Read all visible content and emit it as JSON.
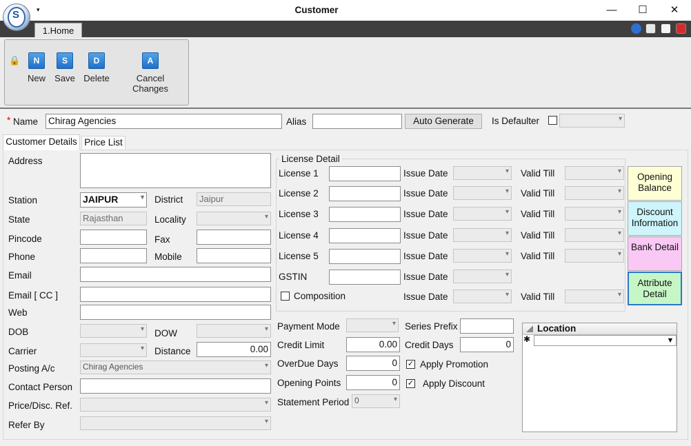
{
  "window": {
    "title": "Customer",
    "minimize": "—",
    "maximize": "☐",
    "close": "✕"
  },
  "tabs": {
    "home": "1.Home"
  },
  "ribbon": {
    "new": "New",
    "save": "Save",
    "delete": "Delete",
    "cancel": "Cancel Changes",
    "new_icon": "N",
    "save_icon": "S",
    "delete_icon": "D",
    "cancel_icon": "A"
  },
  "header": {
    "required_mark": "*",
    "name_label": "Name",
    "name_value": "Chirag Agencies",
    "alias_label": "Alias",
    "alias_value": "",
    "auto_generate": "Auto Generate",
    "defaulter_label": "Is Defaulter"
  },
  "form_tabs": {
    "customer_details": "Customer Details",
    "price_list": "Price List"
  },
  "left": {
    "address": "Address",
    "station": "Station",
    "station_value": "JAIPUR",
    "district": "District",
    "district_value": "Jaipur",
    "state": "State",
    "state_value": "Rajasthan",
    "locality": "Locality",
    "pincode": "Pincode",
    "fax": "Fax",
    "phone": "Phone",
    "mobile": "Mobile",
    "email": "Email",
    "email_cc": "Email [ CC ]",
    "web": "Web",
    "dob": "DOB",
    "dow": "DOW",
    "carrier": "Carrier",
    "distance": "Distance",
    "distance_value": "0.00",
    "posting": "Posting A/c",
    "posting_value": "Chirag Agencies",
    "contact": "Contact Person",
    "price_ref": "Price/Disc. Ref.",
    "refer_by": "Refer By"
  },
  "license": {
    "group": "License Detail",
    "rows": [
      "License 1",
      "License 2",
      "License 3",
      "License 4",
      "License 5"
    ],
    "gstin": "GSTIN",
    "composition": "Composition",
    "issue_date": "Issue Date",
    "valid_till": "Valid Till"
  },
  "side_buttons": {
    "opening": "Opening Balance",
    "discount": "Discount Information",
    "bank": "Bank Detail",
    "attribute": "Attribute Detail"
  },
  "payment": {
    "mode": "Payment Mode",
    "series": "Series Prefix",
    "credit_limit": "Credit Limit",
    "credit_limit_value": "0.00",
    "credit_days": "Credit Days",
    "credit_days_value": "0",
    "overdue": "OverDue Days",
    "overdue_value": "0",
    "apply_promotion": "Apply Promotion",
    "opening_points": "Opening Points",
    "opening_points_value": "0",
    "apply_discount": "Apply Discount",
    "statement": "Statement Period",
    "statement_value": "0"
  },
  "location": {
    "header": "Location",
    "new_row_marker": "✱"
  },
  "colors": {
    "opening": "#ffffd6",
    "discount": "#cdf5fb",
    "bank": "#f9c8f5",
    "attribute": "#c6f6c6"
  }
}
